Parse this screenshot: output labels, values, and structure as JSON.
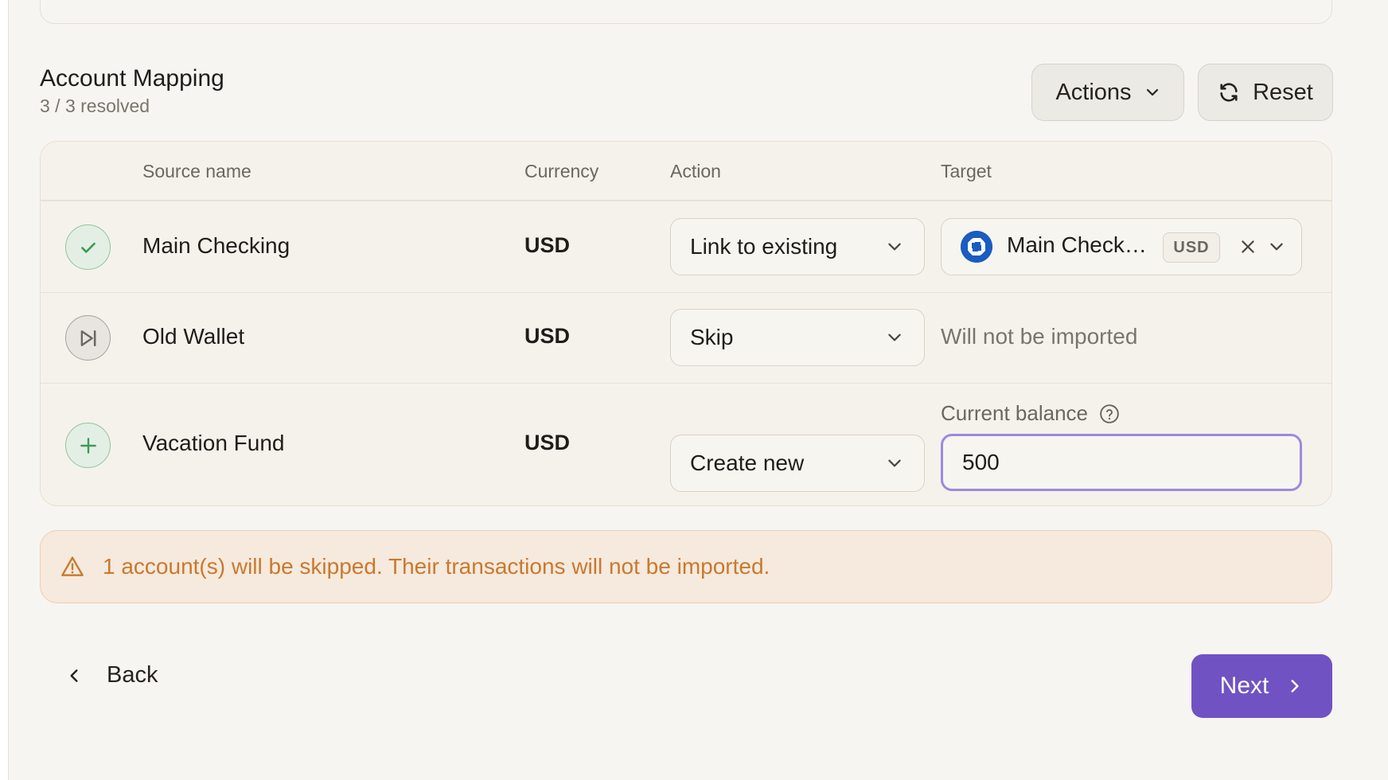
{
  "section": {
    "title": "Account Mapping",
    "subtitle": "3 / 3 resolved"
  },
  "toolbar": {
    "actions_label": "Actions",
    "reset_label": "Reset"
  },
  "table": {
    "headers": {
      "source_name": "Source name",
      "currency": "Currency",
      "action": "Action",
      "target": "Target"
    },
    "rows": [
      {
        "status": "check-icon",
        "source_name": "Main Checking",
        "currency": "USD",
        "action": "Link to existing",
        "target_name": "Main Checking",
        "target_currency": "USD"
      },
      {
        "status": "skip-icon",
        "source_name": "Old Wallet",
        "currency": "USD",
        "action": "Skip",
        "target_text": "Will not be imported"
      },
      {
        "status": "plus-icon",
        "source_name": "Vacation Fund",
        "currency": "USD",
        "action": "Create new",
        "balance_label": "Current balance",
        "balance_value": "500"
      }
    ]
  },
  "alert": {
    "icon": "warning-triangle-icon",
    "text": "1 account(s) will be skipped. Their transactions will not be imported."
  },
  "footer": {
    "back_label": "Back",
    "next_label": "Next"
  },
  "colors": {
    "accent": "#7152c2",
    "success": "#3f9a55",
    "warning": "#c77a2f",
    "focus_ring": "#9b8bdc"
  }
}
